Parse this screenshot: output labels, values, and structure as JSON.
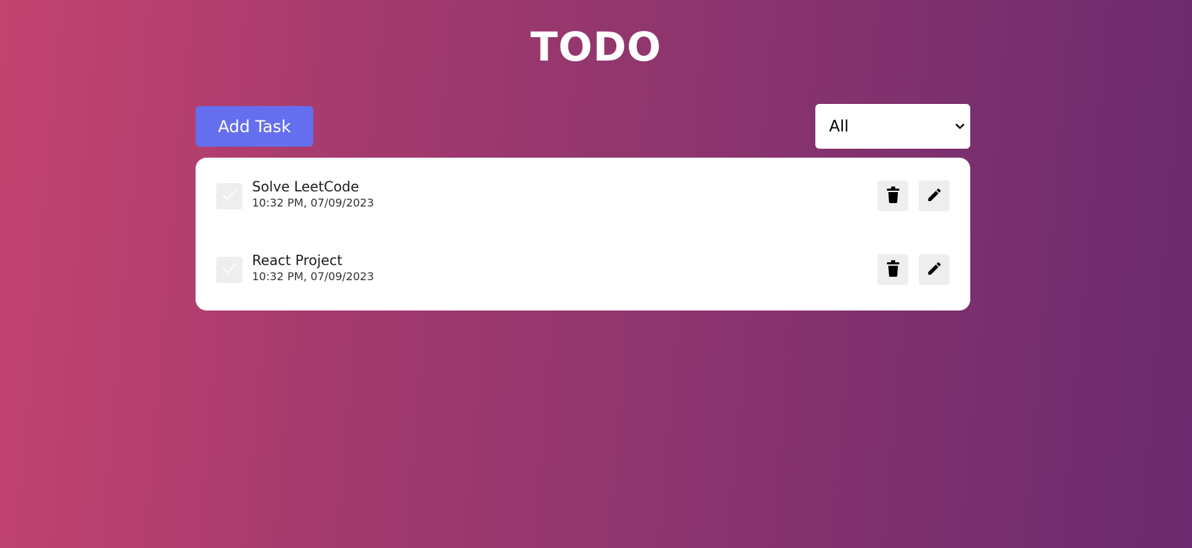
{
  "app": {
    "title": "TODO"
  },
  "toolbar": {
    "add_label": "Add Task",
    "filter": {
      "selected": "All",
      "icon": "chevron-down-icon"
    }
  },
  "tasks": [
    {
      "title": "Solve LeetCode",
      "time": "10:32 PM, 07/09/2023",
      "completed": false,
      "actions": [
        "trash-icon",
        "pencil-icon"
      ]
    },
    {
      "title": "React Project",
      "time": "10:32 PM, 07/09/2023",
      "completed": false,
      "actions": [
        "trash-icon",
        "pencil-icon"
      ]
    }
  ],
  "colors": {
    "accent": "#646ff0",
    "gradient_start": "#c4436f",
    "gradient_end": "#6a2a6d"
  }
}
